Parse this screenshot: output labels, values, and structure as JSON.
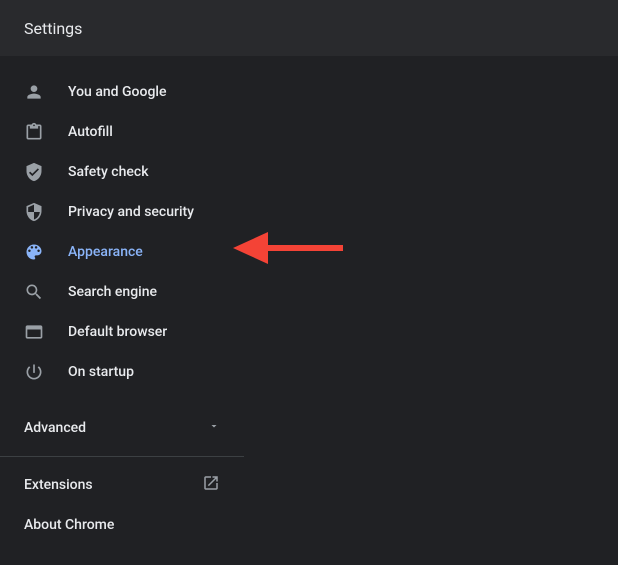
{
  "header": {
    "title": "Settings"
  },
  "nav": {
    "items": [
      {
        "label": "You and Google"
      },
      {
        "label": "Autofill"
      },
      {
        "label": "Safety check"
      },
      {
        "label": "Privacy and security"
      },
      {
        "label": "Appearance"
      },
      {
        "label": "Search engine"
      },
      {
        "label": "Default browser"
      },
      {
        "label": "On startup"
      }
    ]
  },
  "advanced": {
    "label": "Advanced"
  },
  "footer": {
    "extensions": "Extensions",
    "about": "About Chrome"
  },
  "annotation": {
    "arrow_color": "#f44336"
  }
}
